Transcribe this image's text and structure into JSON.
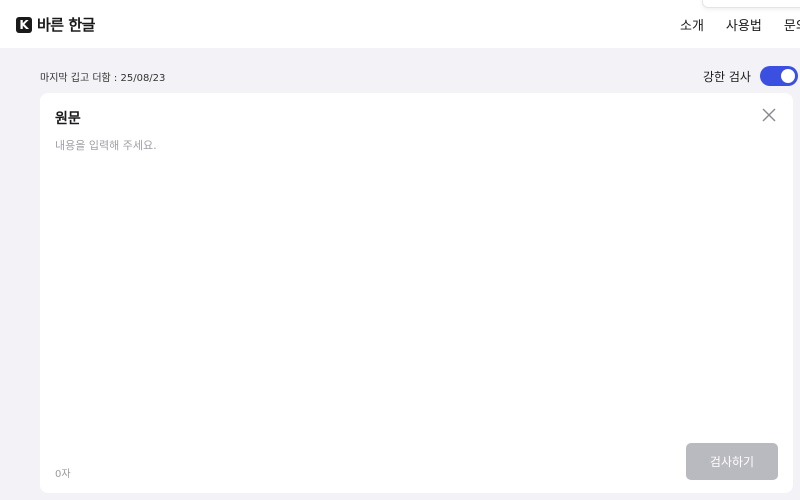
{
  "header": {
    "logo_mark": "K",
    "logo_text": "바른 한글",
    "nav": [
      "소개",
      "사용법",
      "문의"
    ]
  },
  "meta": {
    "last_update": "마지막 깁고 더함 : 25/08/23",
    "strict_check_label": "강한 검사",
    "strict_check_enabled": true
  },
  "editor": {
    "title": "원문",
    "placeholder": "내용을 입력해 주세요.",
    "char_count": "0자",
    "submit_label": "검사하기"
  },
  "colors": {
    "background": "#f2f2f7",
    "toggle_on": "#3b4fe0",
    "button_disabled": "#b9b9c0"
  }
}
